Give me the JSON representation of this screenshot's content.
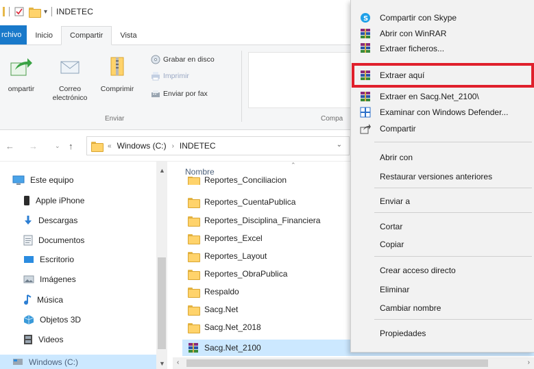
{
  "titlebar": {
    "title": "INDETEC"
  },
  "tabs": [
    {
      "label": "rchivo"
    },
    {
      "label": "Inicio"
    },
    {
      "label": "Compartir"
    },
    {
      "label": "Vista"
    }
  ],
  "ribbon": {
    "share_label": "ompartir",
    "email_line1": "Correo",
    "email_line2": "electrónico",
    "zip_label": "Comprimir",
    "burn_label": "Grabar en disco",
    "print_label": "Imprimir",
    "fax_label": "Enviar por fax",
    "group_send": "Enviar",
    "group_share": "Compa"
  },
  "address": {
    "overflow": "«",
    "crumbs": [
      "Windows (C:)",
      "INDETEC"
    ]
  },
  "nav": {
    "items": [
      {
        "label": "Este equipo"
      },
      {
        "label": "Apple iPhone"
      },
      {
        "label": "Descargas"
      },
      {
        "label": "Documentos"
      },
      {
        "label": "Escritorio"
      },
      {
        "label": "Imágenes"
      },
      {
        "label": "Música"
      },
      {
        "label": "Objetos 3D"
      },
      {
        "label": "Videos"
      },
      {
        "label": "Windows (C:)"
      }
    ]
  },
  "files": {
    "column_name": "Nombre",
    "partial": "Reportes_Conciliacion",
    "items": [
      {
        "label": "Reportes_CuentaPublica"
      },
      {
        "label": "Reportes_Disciplina_Financiera"
      },
      {
        "label": "Reportes_Excel"
      },
      {
        "label": "Reportes_Layout"
      },
      {
        "label": "Reportes_ObraPublica"
      },
      {
        "label": "Respaldo"
      },
      {
        "label": "Sacg.Net"
      },
      {
        "label": "Sacg.Net_2018"
      },
      {
        "label": "Sacg.Net_2100"
      }
    ]
  },
  "context_menu": {
    "items": [
      {
        "label": "Compartir con Skype"
      },
      {
        "label": "Abrir con WinRAR"
      },
      {
        "label": "Extraer ficheros..."
      },
      {
        "label": "Extraer aquí"
      },
      {
        "label": "Extraer en Sacg.Net_2100\\"
      },
      {
        "label": "Examinar con Windows Defender..."
      },
      {
        "label": "Compartir"
      },
      {
        "label": "Abrir con"
      },
      {
        "label": "Restaurar versiones anteriores"
      },
      {
        "label": "Enviar a"
      },
      {
        "label": "Cortar"
      },
      {
        "label": "Copiar"
      },
      {
        "label": "Crear acceso directo"
      },
      {
        "label": "Eliminar"
      },
      {
        "label": "Cambiar nombre"
      },
      {
        "label": "Propiedades"
      }
    ]
  },
  "colors": {
    "accent": "#1979ca",
    "selection": "#cce8ff",
    "highlight": "#e0202c"
  }
}
